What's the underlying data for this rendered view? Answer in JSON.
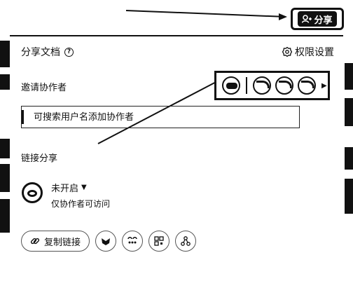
{
  "share_button": {
    "label": "分享",
    "icon": "add-user-icon"
  },
  "panel": {
    "title": "分享文档",
    "help_icon_text": "?",
    "permission_label": "权限设置",
    "invite_label": "邀请协作者",
    "search_placeholder": "可搜索用户名添加协作者",
    "link_share_title": "链接分享",
    "link_status": "未开启",
    "link_status_sub": "仅协作者可访问",
    "copy_link_label": "复制链接",
    "share_icons": [
      "wechat-icon",
      "contacts-icon",
      "qrcode-icon",
      "share-tree-icon"
    ]
  }
}
